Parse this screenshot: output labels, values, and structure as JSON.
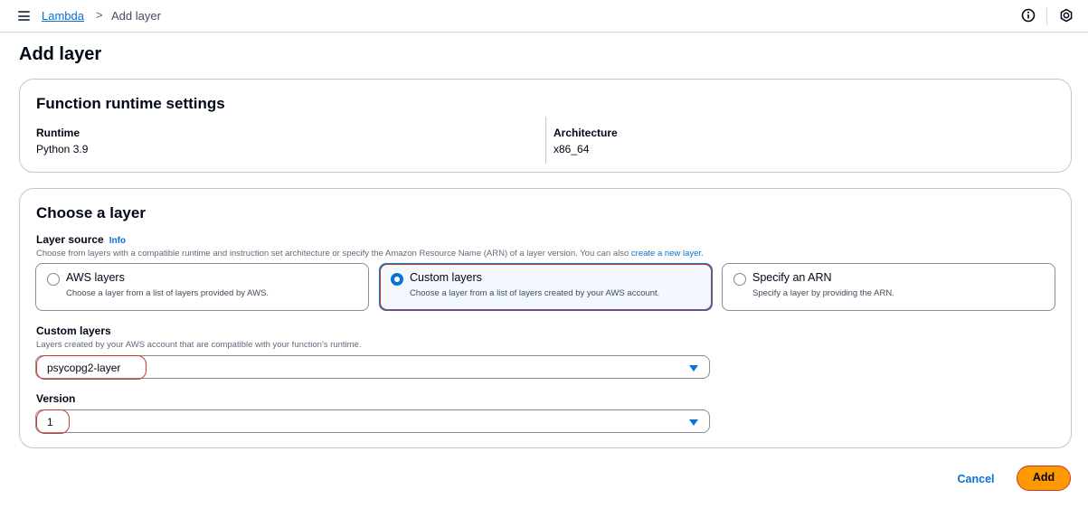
{
  "breadcrumb": {
    "parent": "Lambda",
    "separator": ">",
    "current": "Add layer"
  },
  "header_icons": [
    "info-circle-icon",
    "notifications-icon"
  ],
  "page_title": "Add layer",
  "runtime_settings": {
    "title": "Function runtime settings",
    "runtime_label": "Runtime",
    "runtime_value": "Python 3.9",
    "architecture_label": "Architecture",
    "architecture_value": "x86_64"
  },
  "choose_layer": {
    "title": "Choose a layer",
    "source_label": "Layer source",
    "info_link": "Info",
    "source_desc": "Choose from layers with a compatible runtime and instruction set architecture or specify the Amazon Resource Name (ARN) of a layer version. You can also",
    "source_desc_link": "create a new layer.",
    "options": [
      {
        "title": "AWS layers",
        "desc": "Choose a layer from a list of layers provided by AWS.",
        "selected": false
      },
      {
        "title": "Custom layers",
        "desc": "Choose a layer from a list of layers created by your AWS account.",
        "selected": true
      },
      {
        "title": "Specify an ARN",
        "desc": "Specify a layer by providing the ARN.",
        "selected": false
      }
    ],
    "custom_layers_label": "Custom layers",
    "custom_layers_desc": "Layers created by your AWS account that are compatible with your function's runtime.",
    "custom_layers_value": "psycopg2-layer",
    "version_label": "Version",
    "version_value": "1"
  },
  "actions": {
    "cancel": "Cancel",
    "add": "Add"
  },
  "colors": {
    "accent": "#0972d3",
    "primary_button": "#ff9900",
    "highlight": "#d0362a"
  }
}
